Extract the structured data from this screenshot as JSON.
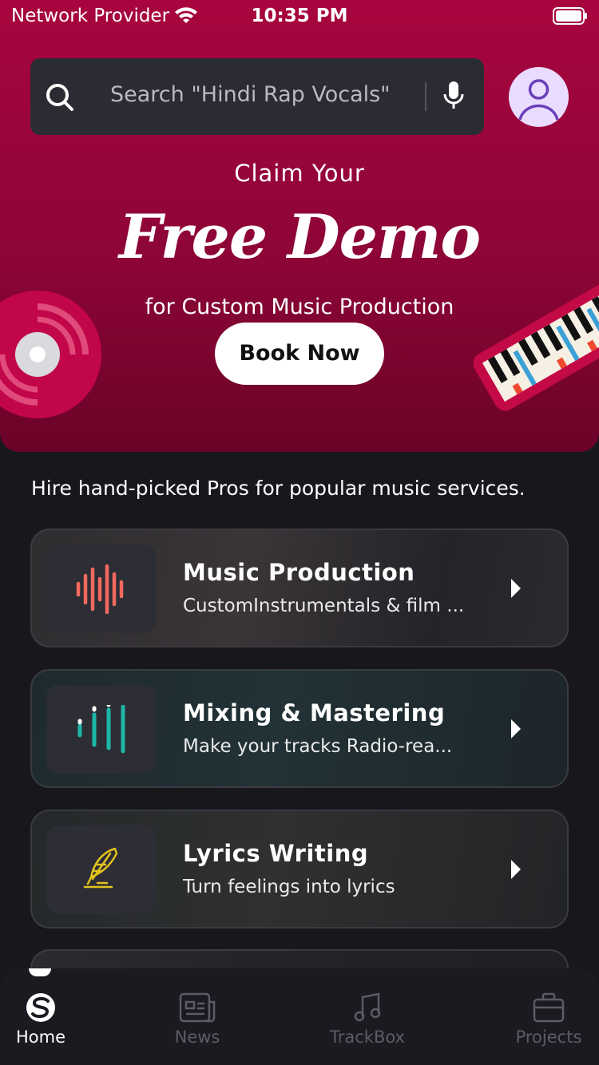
{
  "status_bar": {
    "carrier": "Network Provider",
    "time": "10:35 PM"
  },
  "search": {
    "placeholder": "Search \"Hindi Rap Vocals\""
  },
  "hero": {
    "claim": "Claim Your",
    "headline": "Free Demo",
    "subline": "for Custom Music Production",
    "cta_label": "Book Now",
    "background_color": "#a8053f"
  },
  "services": {
    "heading": "Hire hand-picked Pros for popular music services.",
    "items": [
      {
        "title": "Music Production",
        "subtitle": "CustomInstrumentals & film ...",
        "icon": "waveform-icon",
        "icon_color": "#f2695d"
      },
      {
        "title": "Mixing & Mastering",
        "subtitle": "Make your tracks Radio-rea...",
        "icon": "equalizer-icon",
        "icon_color": "#1db7a8"
      },
      {
        "title": "Lyrics Writing",
        "subtitle": "Turn feelings into lyrics",
        "icon": "quill-icon",
        "icon_color": "#e2c21d"
      }
    ]
  },
  "tab_bar": {
    "tabs": [
      {
        "label": "Home",
        "icon": "home-logo-icon",
        "active": true
      },
      {
        "label": "News",
        "icon": "news-icon",
        "active": false
      },
      {
        "label": "TrackBox",
        "icon": "music-note-icon",
        "active": false
      },
      {
        "label": "Projects",
        "icon": "briefcase-icon",
        "active": false
      }
    ],
    "active_color": "#ffffff",
    "inactive_color": "#5c5c66"
  }
}
